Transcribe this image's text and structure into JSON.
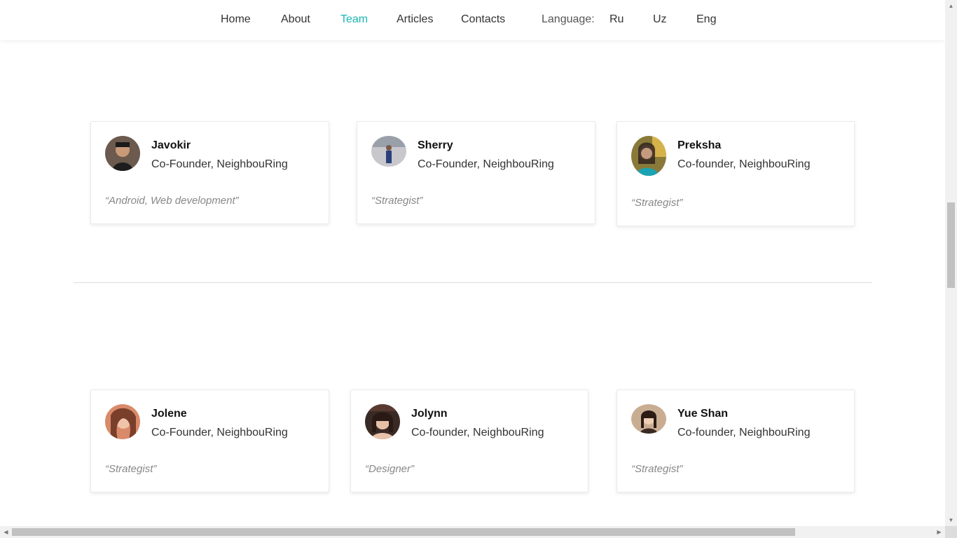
{
  "nav": {
    "links": [
      "Home",
      "About",
      "Team",
      "Articles",
      "Contacts"
    ],
    "active": "Team",
    "language_label": "Language:",
    "languages": [
      "Ru",
      "Uz",
      "Eng"
    ]
  },
  "team": [
    {
      "name": "Javokir",
      "role": "Co-Founder, NeighbouRing",
      "quote": "“Android, Web development”"
    },
    {
      "name": "Sherry",
      "role": "Co-Founder, NeighbouRing",
      "quote": "“Strategist”"
    },
    {
      "name": "Preksha",
      "role": "Co-founder, NeighbouRing",
      "quote": "“Strategist”"
    },
    {
      "name": "Jolene",
      "role": "Co-Founder, NeighbouRing",
      "quote": "“Strategist”"
    },
    {
      "name": "Jolynn",
      "role": "Co-founder, NeighbouRing",
      "quote": "“Designer”"
    },
    {
      "name": "Yue Shan",
      "role": "Co-founder, NeighbouRing",
      "quote": "“Strategist”"
    }
  ],
  "colors": {
    "accent": "#19b7b7",
    "divider": "#dedede"
  },
  "icons": {
    "scroll_up": "▲",
    "scroll_down": "▼",
    "scroll_left": "◀",
    "scroll_right": "▶"
  }
}
